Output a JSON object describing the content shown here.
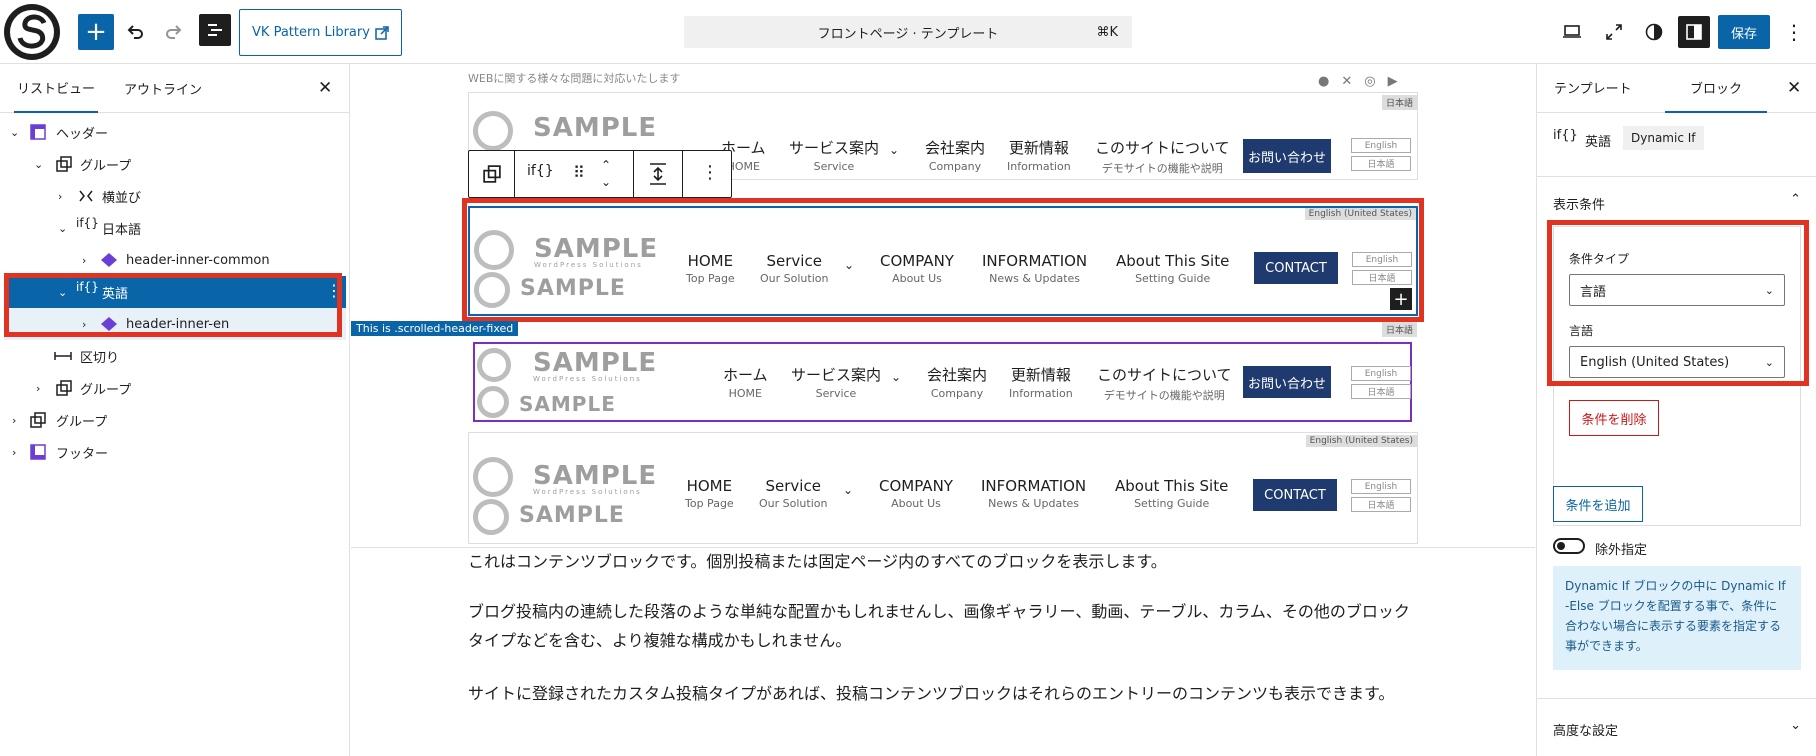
{
  "toolbar": {
    "vk_pattern_library": "VK Pattern Library",
    "command_title": "フロントページ · テンプレート",
    "command_shortcut": "⌘K",
    "save_label": "保存"
  },
  "left_panel": {
    "tabs": [
      "リストビュー",
      "アウトライン"
    ],
    "items": [
      {
        "label": "ヘッダー"
      },
      {
        "label": "グループ"
      },
      {
        "label": "横並び"
      },
      {
        "label": "日本語"
      },
      {
        "label": "header-inner-common"
      },
      {
        "label": "英語"
      },
      {
        "label": "header-inner-en"
      },
      {
        "label": "区切り"
      },
      {
        "label": "グループ"
      },
      {
        "label": "グループ"
      },
      {
        "label": "フッター"
      }
    ]
  },
  "canvas": {
    "tagline": "WEBに関する様々な問題に対応いたします",
    "logo_text": "SAMPLE",
    "logo_sub": "WordPress Solutions",
    "tag_jp": "日本語",
    "tag_en": "English (United States)",
    "scrolled_label": "This is .scrolled-header-fixed",
    "nav_jp": [
      {
        "main": "ホーム",
        "sub": "HOME"
      },
      {
        "main": "サービス案内",
        "sub": "Service"
      },
      {
        "main": "会社案内",
        "sub": "Company"
      },
      {
        "main": "更新情報",
        "sub": "Information"
      },
      {
        "main": "このサイトについて",
        "sub": "デモサイトの機能や説明"
      }
    ],
    "nav_en": [
      {
        "main": "HOME",
        "sub": "Top Page"
      },
      {
        "main": "Service",
        "sub": "Our Solution"
      },
      {
        "main": "COMPANY",
        "sub": "About Us"
      },
      {
        "main": "INFORMATION",
        "sub": "News & Updates"
      },
      {
        "main": "About This Site",
        "sub": "Setting Guide"
      }
    ],
    "contact_jp": "お問い合わせ",
    "contact_en": "CONTACT",
    "lang_english": "English",
    "lang_japanese": "日本語",
    "paragraphs": [
      "これはコンテンツブロックです。個別投稿または固定ページ内のすべてのブロックを表示します。",
      "ブログ投稿内の連続した段落のような単純な配置かもしれませんし、画像ギャラリー、動画、テーブル、カラム、その他のブロック",
      "タイプなどを含む、より複雑な構成かもしれません。",
      "サイトに登録されたカスタム投稿タイプがあれば、投稿コンテンツブロックはそれらのエントリーのコンテンツも表示できます。"
    ]
  },
  "sidebar": {
    "tabs": [
      "テンプレート",
      "ブロック"
    ],
    "block_name": "英語",
    "block_type": "Dynamic If",
    "section_title": "表示条件",
    "condition_type_label": "条件タイプ",
    "condition_type_value": "言語",
    "language_label": "言語",
    "language_value": "English (United States)",
    "delete_condition": "条件を削除",
    "add_condition": "条件を追加",
    "exclude_label": "除外指定",
    "info_text": "Dynamic If ブロックの中に Dynamic If -Else ブロックを配置する事で、条件に合わない場合に表示する要素を指定する事ができます。",
    "advanced": "高度な設定"
  },
  "colors": {
    "accent": "#0a64a8",
    "highlight": "#e03322",
    "navy": "#1f3a6e"
  }
}
